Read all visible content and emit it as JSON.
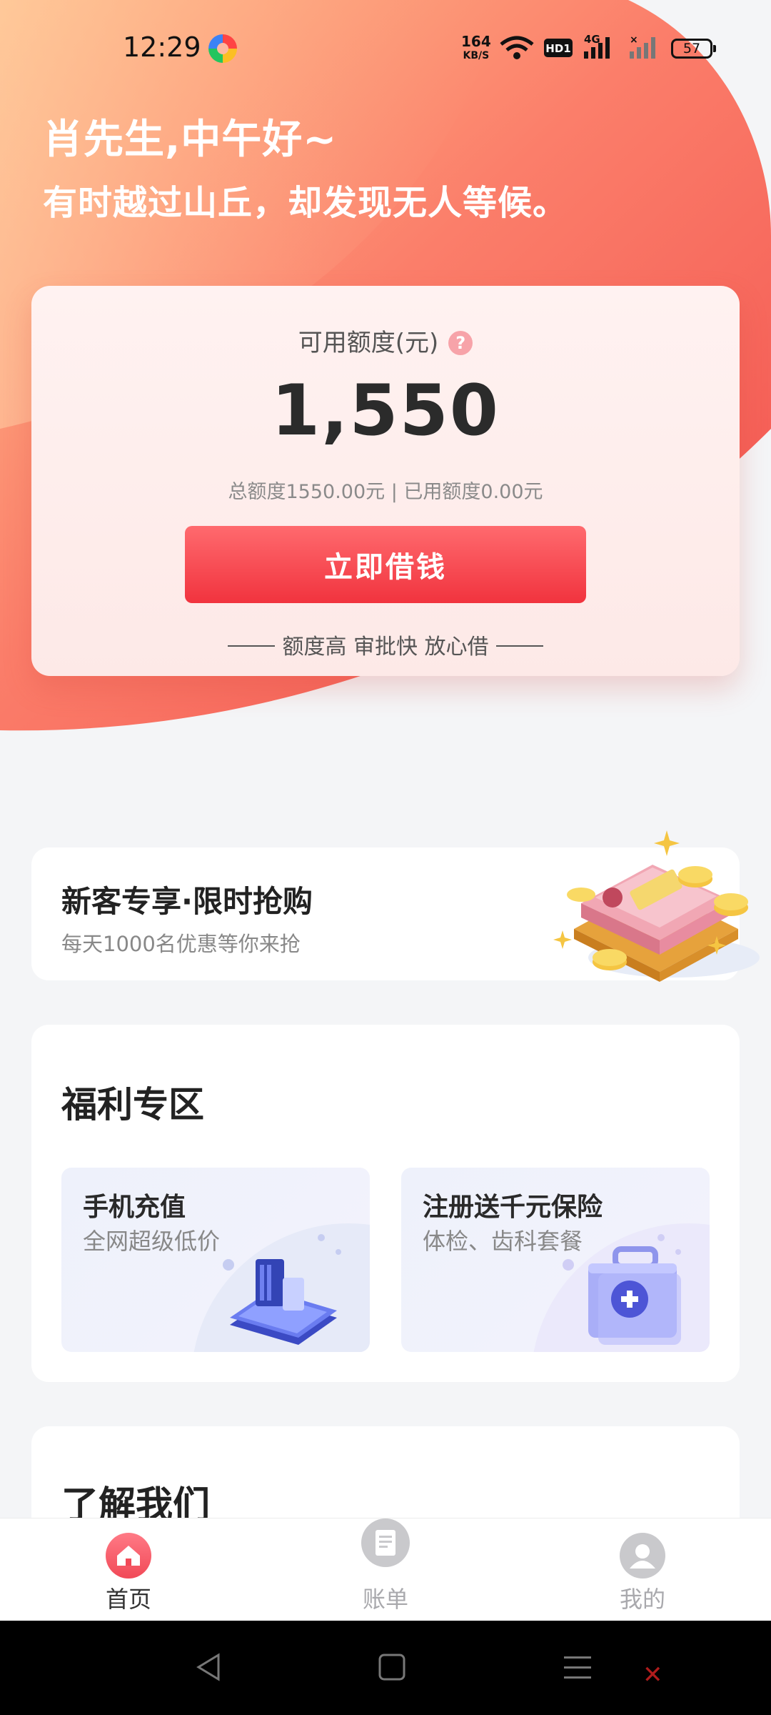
{
  "status_bar": {
    "time": "12:29",
    "net_speed_value": "164",
    "net_speed_unit": "KB/S",
    "hd_badge": "HD1",
    "network_type": "4G",
    "battery_level": "57",
    "icons": [
      "app-notification-icon",
      "wifi-icon",
      "hd-voice-icon",
      "signal-4g-icon",
      "signal-no-service-icon",
      "battery-icon"
    ]
  },
  "header": {
    "greeting": "肖先生,中午好~",
    "quote": "有时越过山丘，却发现无人等候。"
  },
  "credit": {
    "label": "可用额度(元)",
    "help_icon": "?",
    "amount": "1,550",
    "summary": "总额度1550.00元 | 已用额度0.00元",
    "borrow_button": "立即借钱",
    "slogan": "额度高 审批快 放心借"
  },
  "promo": {
    "title": "新客专享·限时抢购",
    "subtitle": "每天1000名优惠等你来抢",
    "art_icon": "money-stack-illustration"
  },
  "welfare": {
    "title": "福利专区",
    "items": [
      {
        "title": "手机充值",
        "subtitle": "全网超级低价",
        "icon": "phone-card-illustration"
      },
      {
        "title": "注册送千元保险",
        "subtitle": "体检、齿科套餐",
        "icon": "medical-kit-illustration"
      }
    ]
  },
  "about": {
    "title": "了解我们"
  },
  "tab_bar": {
    "tabs": [
      {
        "label": "首页",
        "icon": "home-icon",
        "active": true
      },
      {
        "label": "账单",
        "icon": "bill-icon",
        "active": false
      },
      {
        "label": "我的",
        "icon": "profile-icon",
        "active": false
      }
    ]
  },
  "system_nav": {
    "buttons": [
      "back-icon",
      "home-square-icon",
      "menu-icon"
    ]
  },
  "colors": {
    "hero_gradient_start": "#ffb07a",
    "hero_gradient_end": "#f24f4d",
    "primary_button": "#f1333e",
    "active_tab": "#f14957",
    "inactive_tab": "#a9a9ad"
  }
}
